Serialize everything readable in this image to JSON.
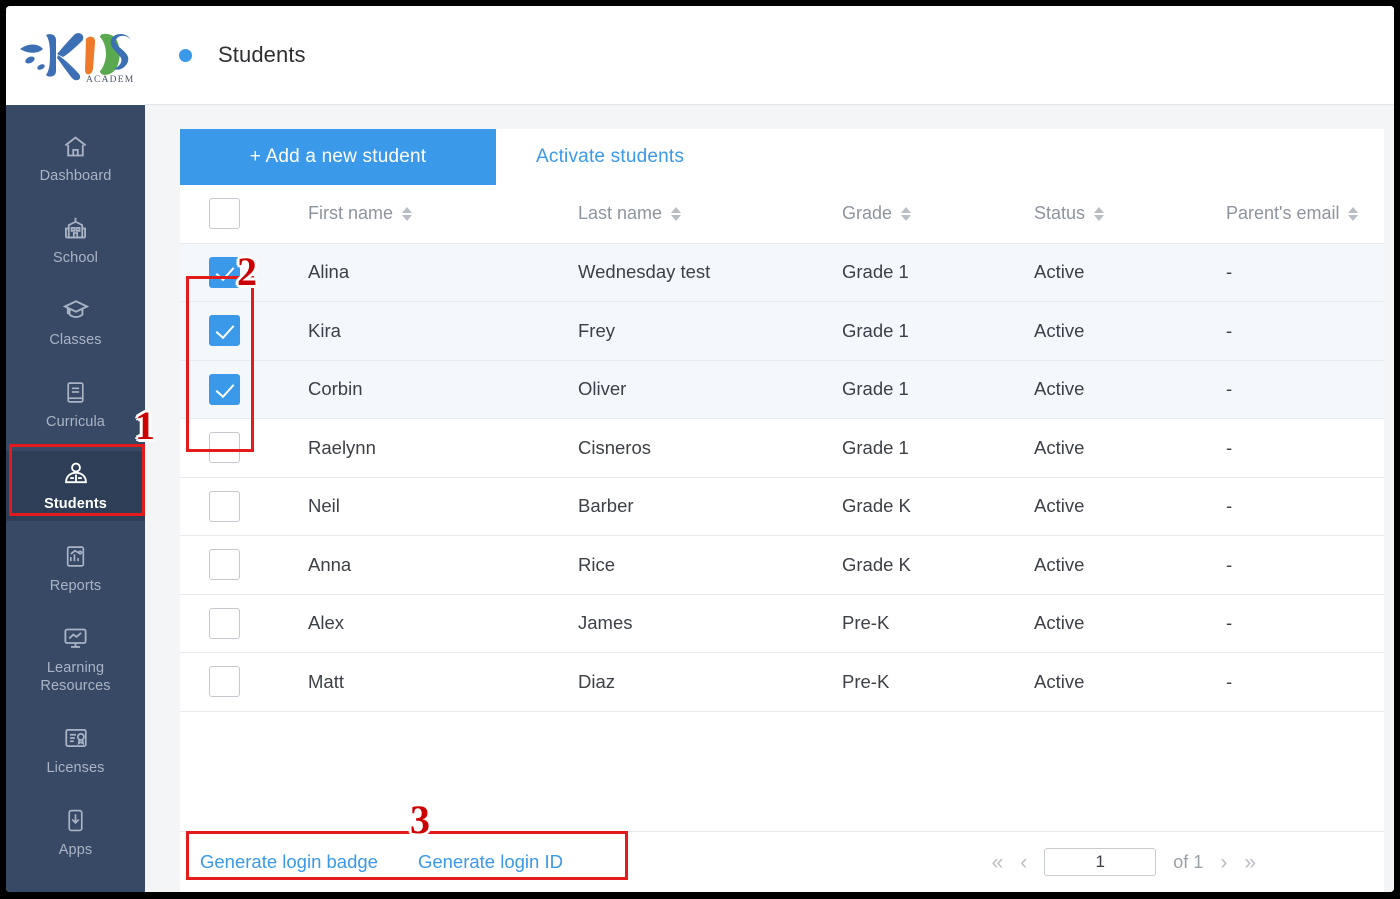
{
  "logo": {
    "name": "KIDS",
    "subtitle": "ACADEMY",
    "letters": [
      "K",
      "I",
      "D",
      "S"
    ],
    "colors": {
      "k": "#3d6fb4",
      "i": "#ee7b2b",
      "d": "#5aa84f",
      "s": "#3d6fb4",
      "splash": "#3d6fb4",
      "academy": "#4a5568"
    }
  },
  "sidebar": {
    "items": [
      {
        "label": "Dashboard",
        "icon": "home-icon",
        "active": false
      },
      {
        "label": "School",
        "icon": "school-building-icon",
        "active": false
      },
      {
        "label": "Classes",
        "icon": "graduation-cap-icon",
        "active": false
      },
      {
        "label": "Curricula",
        "icon": "book-icon",
        "active": false
      },
      {
        "label": "Students",
        "icon": "students-icon",
        "active": true
      },
      {
        "label": "Reports",
        "icon": "reports-chart-icon",
        "active": false
      },
      {
        "label": "Learning\nResources",
        "icon": "monitor-icon",
        "active": false
      },
      {
        "label": "Licenses",
        "icon": "certificate-icon",
        "active": false
      },
      {
        "label": "Apps",
        "icon": "download-app-icon",
        "active": false
      }
    ]
  },
  "header": {
    "breadcrumb_dot": "bullet-dot-icon",
    "title": "Students"
  },
  "toolbar": {
    "add_student_label": "+ Add a new student",
    "activate_students_label": "Activate students",
    "add_button_color": "#3a99e8",
    "link_color": "#3a99e8"
  },
  "table": {
    "select_all_checked": false,
    "columns": [
      {
        "key": "check",
        "label": "",
        "sortable": false
      },
      {
        "key": "first_name",
        "label": "First name",
        "sortable": true
      },
      {
        "key": "last_name",
        "label": "Last name",
        "sortable": true
      },
      {
        "key": "grade",
        "label": "Grade",
        "sortable": true
      },
      {
        "key": "status",
        "label": "Status",
        "sortable": true
      },
      {
        "key": "parent_email",
        "label": "Parent's email",
        "sortable": true
      }
    ],
    "rows": [
      {
        "checked": true,
        "first_name": "Alina",
        "last_name": "Wednesday test",
        "grade": "Grade 1",
        "status": "Active",
        "parent_email": "-"
      },
      {
        "checked": true,
        "first_name": "Kira",
        "last_name": "Frey",
        "grade": "Grade 1",
        "status": "Active",
        "parent_email": "-"
      },
      {
        "checked": true,
        "first_name": "Corbin",
        "last_name": "Oliver",
        "grade": "Grade 1",
        "status": "Active",
        "parent_email": "-"
      },
      {
        "checked": false,
        "first_name": "Raelynn",
        "last_name": "Cisneros",
        "grade": "Grade 1",
        "status": "Active",
        "parent_email": "-"
      },
      {
        "checked": false,
        "first_name": "Neil",
        "last_name": "Barber",
        "grade": "Grade K",
        "status": "Active",
        "parent_email": "-"
      },
      {
        "checked": false,
        "first_name": "Anna",
        "last_name": "Rice",
        "grade": "Grade K",
        "status": "Active",
        "parent_email": "-"
      },
      {
        "checked": false,
        "first_name": "Alex",
        "last_name": "James",
        "grade": "Pre-K",
        "status": "Active",
        "parent_email": "-"
      },
      {
        "checked": false,
        "first_name": "Matt",
        "last_name": "Diaz",
        "grade": "Pre-K",
        "status": "Active",
        "parent_email": "-"
      }
    ]
  },
  "footer": {
    "generate_login_badge": "Generate login badge",
    "generate_login_id": "Generate login ID",
    "pagination": {
      "first_icon": "«",
      "prev_icon": "‹",
      "page_value": "1",
      "of_text": "of 1",
      "next_icon": "›",
      "last_icon": "»"
    }
  },
  "annotations": {
    "color": "#e31b1b",
    "markers": [
      {
        "number": "1",
        "target": "sidebar-students-item"
      },
      {
        "number": "2",
        "target": "selected-row-checkboxes"
      },
      {
        "number": "3",
        "target": "generate-login-links"
      }
    ]
  }
}
